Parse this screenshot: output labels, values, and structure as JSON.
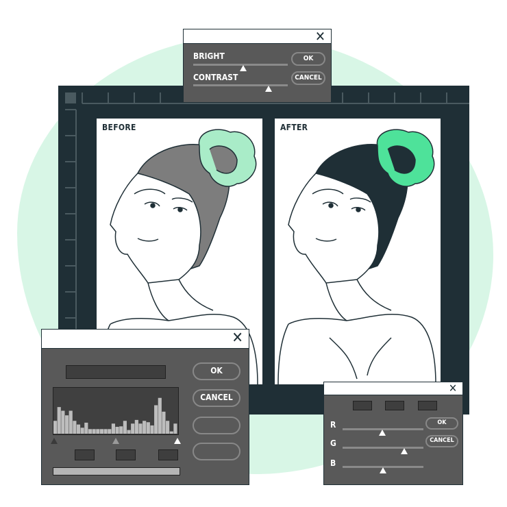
{
  "colors": {
    "accent": "#4ee29a",
    "accent_light": "#a9ecc8",
    "dark": "#1f2f36",
    "dialog": "#595959",
    "background_blob": "#d8f6e6"
  },
  "top_dialog": {
    "bright_label": "BRIGHT",
    "contrast_label": "CONTRAST",
    "ok": "OK",
    "cancel": "CANCEL",
    "bright_value": 0.53,
    "contrast_value": 0.8,
    "close_icon": "close-icon"
  },
  "panels": {
    "before": "BEFORE",
    "after": "AFTER"
  },
  "levels_dialog": {
    "ok": "OK",
    "cancel": "CANCEL",
    "histogram": [
      0.28,
      0.58,
      0.5,
      0.4,
      0.5,
      0.28,
      0.2,
      0.13,
      0.24,
      0.1,
      0.1,
      0.1,
      0.1,
      0.1,
      0.1,
      0.22,
      0.15,
      0.16,
      0.28,
      0.08,
      0.22,
      0.3,
      0.22,
      0.28,
      0.25,
      0.18,
      0.62,
      0.78,
      0.48,
      0.28,
      0.05,
      0.22
    ],
    "markers": [
      0,
      0.5,
      1
    ]
  },
  "rgb_dialog": {
    "r_label": "R",
    "g_label": "G",
    "b_label": "B",
    "ok": "OK",
    "cancel": "CANCEL",
    "r": 0.49,
    "g": 0.76,
    "b": 0.5
  }
}
